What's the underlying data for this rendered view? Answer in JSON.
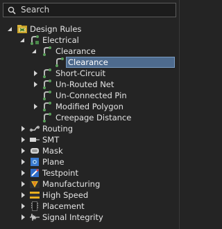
{
  "search": {
    "placeholder": "Search",
    "value": ""
  },
  "tree": {
    "root_label": "Design Rules",
    "electrical_label": "Electrical",
    "clearance_group_label": "Clearance",
    "clearance_rule_label": "Clearance",
    "short_circuit_label": "Short-Circuit",
    "unrouted_net_label": "Un-Routed Net",
    "unconnected_pin_label": "Un-Connected Pin",
    "modified_polygon_label": "Modified Polygon",
    "creepage_label": "Creepage Distance",
    "routing_label": "Routing",
    "smt_label": "SMT",
    "mask_label": "Mask",
    "plane_label": "Plane",
    "testpoint_label": "Testpoint",
    "manufacturing_label": "Manufacturing",
    "high_speed_label": "High Speed",
    "placement_label": "Placement",
    "signal_integrity_label": "Signal Integrity"
  },
  "colors": {
    "background": "#242424",
    "selection": "#4e6b8e",
    "text": "#e4e4e4"
  },
  "icons": {
    "search": "search-icon",
    "expanded": "expanded-arrow-icon",
    "collapsed": "collapsed-arrow-icon",
    "rule": "rule-icon",
    "design_rules": "design-rules-icon"
  }
}
